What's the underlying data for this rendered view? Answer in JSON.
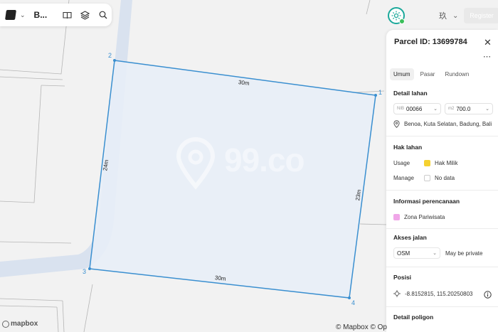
{
  "toolbar": {
    "map_type_label": "B...",
    "icons": [
      "map-layer-icon",
      "chevron-down-icon",
      "book-icon",
      "layers-icon",
      "search-icon"
    ]
  },
  "top_right": {
    "status_icon": "sun-icon",
    "language_icon": "translate-icon",
    "register_label": "Register"
  },
  "map": {
    "watermark": "99.co",
    "dimensions": {
      "top": "30m",
      "left": "24m",
      "right": "23m",
      "bottom": "30m"
    },
    "vertices": [
      "1",
      "2",
      "3",
      "4"
    ],
    "colors": {
      "parcel_stroke": "#3a8fd0",
      "parcel_fill": "#e8eef8",
      "road": "#d9e2ef"
    }
  },
  "attribution": {
    "mapbox_logo": "mapbox",
    "text": "© Mapbox © Op"
  },
  "panel": {
    "title": "Parcel ID: 13699784",
    "tabs": [
      {
        "label": "Umum",
        "active": true
      },
      {
        "label": "Pasar",
        "active": false
      },
      {
        "label": "Rundown",
        "active": false
      }
    ],
    "detail_lahan": {
      "title": "Detail lahan",
      "nib_prefix": "NIB",
      "nib_value": "00066",
      "area_prefix": "m2",
      "area_value": "700.0",
      "address": "Benoa, Kuta Selatan, Badung, Bali"
    },
    "hak_lahan": {
      "title": "Hak lahan",
      "usage_label": "Usage",
      "usage_value": "Hak Milik",
      "usage_color": "#f5d130",
      "manage_label": "Manage",
      "manage_value": "No data"
    },
    "informasi_perencanaan": {
      "title": "Informasi perencanaan",
      "zone_value": "Zona Pariwisata",
      "zone_color": "#f0a6e8"
    },
    "akses_jalan": {
      "title": "Akses jalan",
      "source_value": "OSM",
      "access_value": "May be private"
    },
    "posisi": {
      "title": "Posisi",
      "coordinates": "-8.8152815, 115.20250803"
    },
    "detail_poligon": {
      "title": "Detail poligon"
    }
  }
}
